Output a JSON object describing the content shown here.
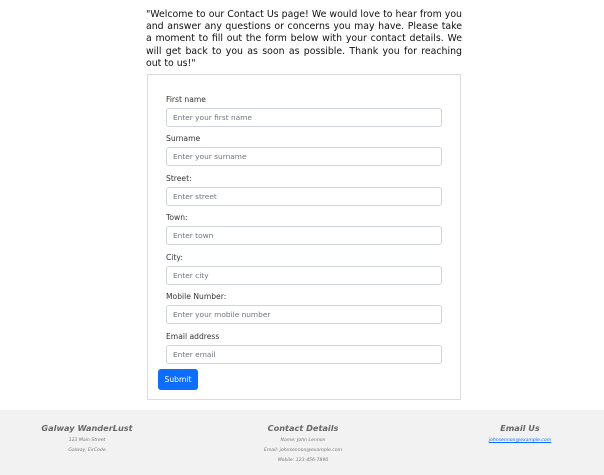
{
  "intro": {
    "text": "\"Welcome to our Contact Us page! We would love to hear from you and answer any questions or concerns you may have. Please take a moment to fill out the form below with your contact details. We will get back to you as soon as possible. Thank you for reaching out to us!\""
  },
  "form": {
    "fields": [
      {
        "label": "First name",
        "placeholder": "Enter your first name",
        "value": ""
      },
      {
        "label": "Surname",
        "placeholder": "Enter your surname",
        "value": ""
      },
      {
        "label": "Street:",
        "placeholder": "Enter street",
        "value": ""
      },
      {
        "label": "Town:",
        "placeholder": "Enter town",
        "value": ""
      },
      {
        "label": "City:",
        "placeholder": "Enter city",
        "value": ""
      },
      {
        "label": "Mobile Number:",
        "placeholder": "Enter your mobile number",
        "value": ""
      },
      {
        "label": "Email address",
        "placeholder": "Enter email",
        "value": ""
      }
    ],
    "submit_label": "Submit",
    "accent_color": "#0d6efd"
  },
  "footer": {
    "company": {
      "title": "Galway WanderLust",
      "line1": "123 Main Street",
      "line2": "Galway, EirCode"
    },
    "contact": {
      "title": "Contact Details",
      "name": "Name: John Lennon",
      "email": "Email: johnsennon@example.com",
      "mobile": "Mobile: 123-456-7890"
    },
    "email_us": {
      "title": "Email Us",
      "link": "johnsennon@example.com"
    },
    "background": "#f2f2f2"
  }
}
